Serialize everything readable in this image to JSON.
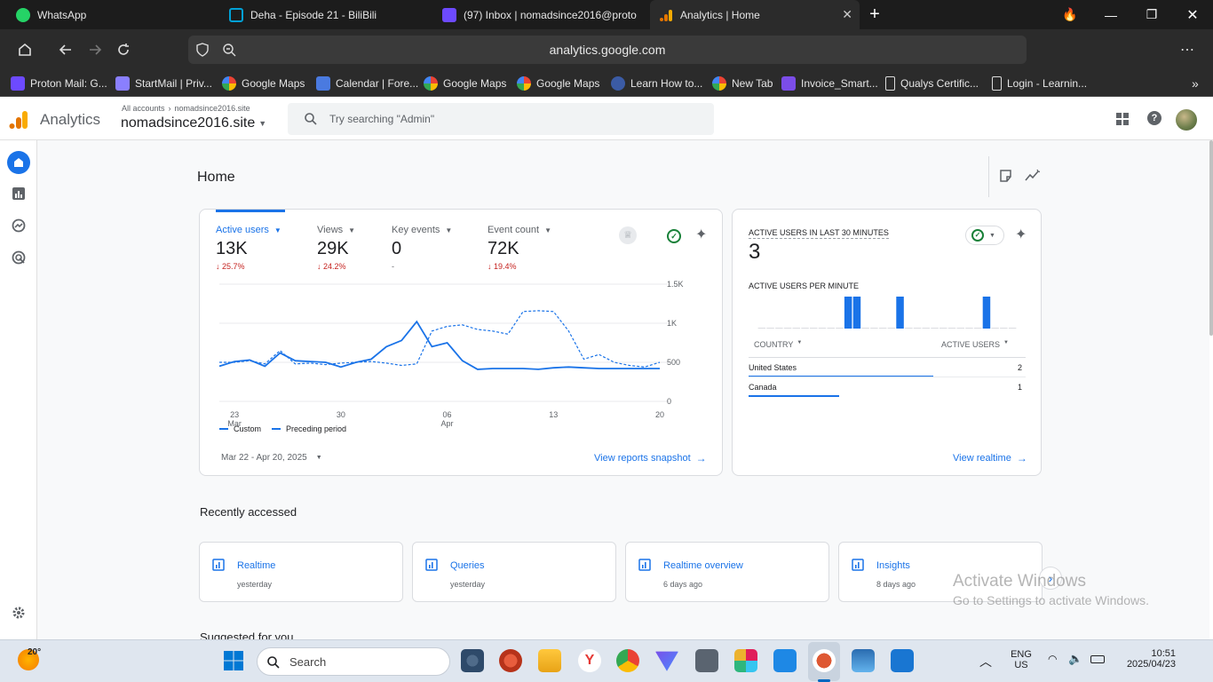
{
  "browser": {
    "tabs": [
      {
        "title": "WhatsApp",
        "icon": "whatsapp-icon"
      },
      {
        "title": "Deha - Episode 21 - BiliBili",
        "icon": "bilibili-icon"
      },
      {
        "title": "(97) Inbox | nomadsince2016@proto",
        "icon": "proton-mail-icon"
      },
      {
        "title": "Analytics | Home",
        "icon": "analytics-icon"
      }
    ],
    "url": "analytics.google.com",
    "bookmarks": [
      "Proton Mail: G...",
      "StartMail | Priv...",
      "Google Maps",
      "Calendar | Fore...",
      "Google Maps",
      "Google Maps",
      "Learn How to...",
      "New Tab",
      "Invoice_Smart...",
      "Qualys Certific...",
      "Login - Learnin..."
    ]
  },
  "ga": {
    "product": "Analytics",
    "breadcrumb_root": "All accounts",
    "breadcrumb_child": "nomadsince2016.site",
    "property": "nomadsince2016.site",
    "search_placeholder": "Try searching \"Admin\"",
    "page_title": "Home"
  },
  "metrics": [
    {
      "label": "Active users",
      "value": "13K",
      "change": "25.7%"
    },
    {
      "label": "Views",
      "value": "29K",
      "change": "24.2%"
    },
    {
      "label": "Key events",
      "value": "0",
      "change": "-"
    },
    {
      "label": "Event count",
      "value": "72K",
      "change": "19.4%"
    }
  ],
  "chart_data": {
    "type": "line",
    "x": [
      "Mar 22",
      "Mar 23",
      "Mar 24",
      "Mar 25",
      "Mar 26",
      "Mar 27",
      "Mar 28",
      "Mar 29",
      "Mar 30",
      "Mar 31",
      "Apr 1",
      "Apr 2",
      "Apr 3",
      "Apr 4",
      "Apr 5",
      "Apr 6",
      "Apr 7",
      "Apr 8",
      "Apr 9",
      "Apr 10",
      "Apr 11",
      "Apr 12",
      "Apr 13",
      "Apr 14",
      "Apr 15",
      "Apr 16",
      "Apr 17",
      "Apr 18",
      "Apr 19",
      "Apr 20"
    ],
    "series": [
      {
        "name": "Custom",
        "values": [
          450,
          510,
          530,
          450,
          620,
          520,
          510,
          500,
          440,
          500,
          540,
          700,
          780,
          1020,
          700,
          750,
          520,
          410,
          420,
          420,
          420,
          410,
          430,
          440,
          430,
          420,
          420,
          420,
          420,
          420
        ]
      },
      {
        "name": "Preceding period",
        "values": [
          500,
          500,
          520,
          480,
          650,
          480,
          490,
          470,
          490,
          500,
          510,
          490,
          460,
          480,
          900,
          960,
          980,
          920,
          900,
          860,
          1150,
          1160,
          1150,
          900,
          540,
          600,
          500,
          460,
          440,
          500
        ]
      }
    ],
    "y_ticks": [
      "1.5K",
      "1K",
      "500",
      "0"
    ],
    "ylim": [
      0,
      1500
    ],
    "x_ticks": [
      {
        "day": "23",
        "month": "Mar"
      },
      {
        "day": "30",
        "month": ""
      },
      {
        "day": "06",
        "month": "Apr"
      },
      {
        "day": "13",
        "month": ""
      },
      {
        "day": "20",
        "month": ""
      }
    ],
    "legend": [
      "Custom",
      "Preceding period"
    ],
    "date_range": "Mar 22 - Apr 20, 2025",
    "realtime_bars": [
      0,
      0,
      0,
      0,
      0,
      0,
      0,
      0,
      0,
      0,
      1,
      1,
      0,
      0,
      0,
      0,
      1,
      0,
      0,
      0,
      0,
      0,
      0,
      0,
      0,
      0,
      1,
      0,
      0,
      0
    ]
  },
  "links": {
    "view_snapshot": "View reports snapshot",
    "view_realtime": "View realtime"
  },
  "realtime": {
    "title": "ACTIVE USERS IN LAST 30 MINUTES",
    "count": "3",
    "per_minute": "ACTIVE USERS PER MINUTE",
    "col_country": "COUNTRY",
    "col_users": "ACTIVE USERS",
    "rows": [
      {
        "country": "United States",
        "users": "2",
        "share": 0.67
      },
      {
        "country": "Canada",
        "users": "1",
        "share": 0.33
      }
    ]
  },
  "recent": {
    "heading": "Recently accessed",
    "items": [
      {
        "title": "Realtime",
        "when": "yesterday"
      },
      {
        "title": "Queries",
        "when": "yesterday"
      },
      {
        "title": "Realtime overview",
        "when": "6 days ago"
      },
      {
        "title": "Insights",
        "when": "8 days ago"
      }
    ],
    "suggested": "Suggested for you"
  },
  "watermark": {
    "line1": "Activate Windows",
    "line2": "Go to Settings to activate Windows."
  },
  "taskbar": {
    "weather": "20°",
    "search": "Search",
    "lang1": "ENG",
    "lang2": "US",
    "time": "10:51",
    "date": "2025/04/23"
  },
  "colors": {
    "accent": "#1a73e8",
    "negative": "#c5221f",
    "positive": "#188038",
    "ga_orange": "#f9ab00",
    "ga_dark_orange": "#e37400"
  }
}
